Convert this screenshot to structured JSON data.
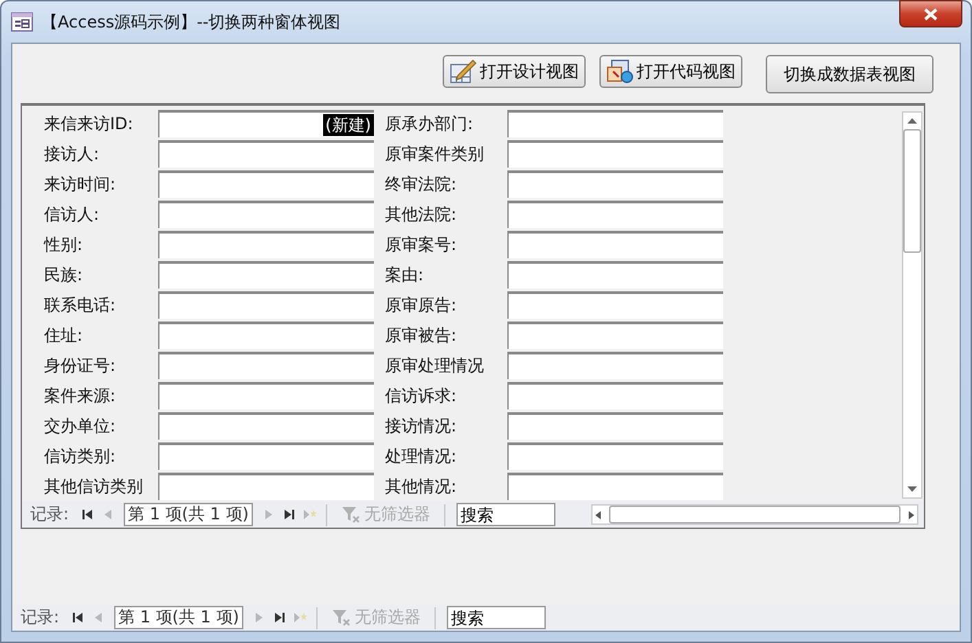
{
  "window": {
    "title": "【Access源码示例】--切换两种窗体视图"
  },
  "buttons": [
    {
      "label": "打开设计视图",
      "kind": "design"
    },
    {
      "label": "打开代码视图",
      "kind": "code"
    },
    {
      "label": "切换成数据表视图",
      "kind": "plain"
    }
  ],
  "form": {
    "left_fields": [
      {
        "label": "来信来访ID:",
        "value": "(新建)"
      },
      {
        "label": "接访人:"
      },
      {
        "label": "来访时间:"
      },
      {
        "label": "信访人:"
      },
      {
        "label": "性别:"
      },
      {
        "label": "民族:"
      },
      {
        "label": "联系电话:"
      },
      {
        "label": "住址:"
      },
      {
        "label": "身份证号:"
      },
      {
        "label": "案件来源:"
      },
      {
        "label": "交办单位:"
      },
      {
        "label": "信访类别:"
      },
      {
        "label": "其他信访类别"
      }
    ],
    "right_fields": [
      {
        "label": "原承办部门:"
      },
      {
        "label": "原审案件类别"
      },
      {
        "label": "终审法院:"
      },
      {
        "label": "其他法院:"
      },
      {
        "label": "原审案号:"
      },
      {
        "label": "案由:"
      },
      {
        "label": "原审原告:"
      },
      {
        "label": "原审被告:"
      },
      {
        "label": "原审处理情况"
      },
      {
        "label": "信访诉求:"
      },
      {
        "label": "接访情况:"
      },
      {
        "label": "处理情况:"
      },
      {
        "label": "其他情况:"
      }
    ]
  },
  "subform_nav": {
    "label": "记录:",
    "position": "第 1 项(共 1 项)",
    "filter": {
      "label": "无筛选器",
      "disabled": true
    },
    "search": {
      "placeholder": "搜索"
    },
    "nav_buttons": [
      {
        "kind": "first",
        "disabled": false
      },
      {
        "kind": "prev",
        "disabled": true
      },
      {
        "kind": "next",
        "disabled": true
      },
      {
        "kind": "last",
        "disabled": false
      },
      {
        "kind": "new",
        "disabled": true
      }
    ]
  },
  "main_nav": {
    "label": "记录:",
    "position": "第 1 项(共 1 项)",
    "filter": {
      "label": "无筛选器",
      "disabled": true
    },
    "search": {
      "placeholder": "搜索"
    },
    "nav_buttons": [
      {
        "kind": "first",
        "disabled": false
      },
      {
        "kind": "prev",
        "disabled": true
      },
      {
        "kind": "next",
        "disabled": true
      },
      {
        "kind": "last",
        "disabled": false
      },
      {
        "kind": "new",
        "disabled": true
      }
    ]
  }
}
